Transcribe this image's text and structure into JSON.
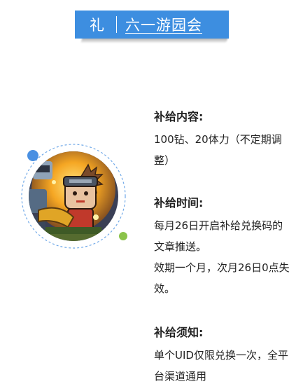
{
  "banner": {
    "gift_char": "礼",
    "title": "六一游园会"
  },
  "image": {
    "description_icon": "game-character-icon"
  },
  "sections": {
    "content": {
      "heading": "补给内容:",
      "lines": [
        "100钻、20体力（不定期调",
        "整）"
      ]
    },
    "time": {
      "heading": "补给时间:",
      "lines": [
        "每月26日开启补给兑换码的",
        "文章推送。",
        "效期一个月，次月26日0点失",
        "效。"
      ]
    },
    "notice": {
      "heading": "补给须知:",
      "lines": [
        "单个UID仅限兑换一次，全平",
        "台渠道通用"
      ]
    }
  },
  "colors": {
    "banner_bg": "#3d8ee0",
    "accent_blue": "#4a90e2",
    "accent_green": "#8bc34a"
  }
}
